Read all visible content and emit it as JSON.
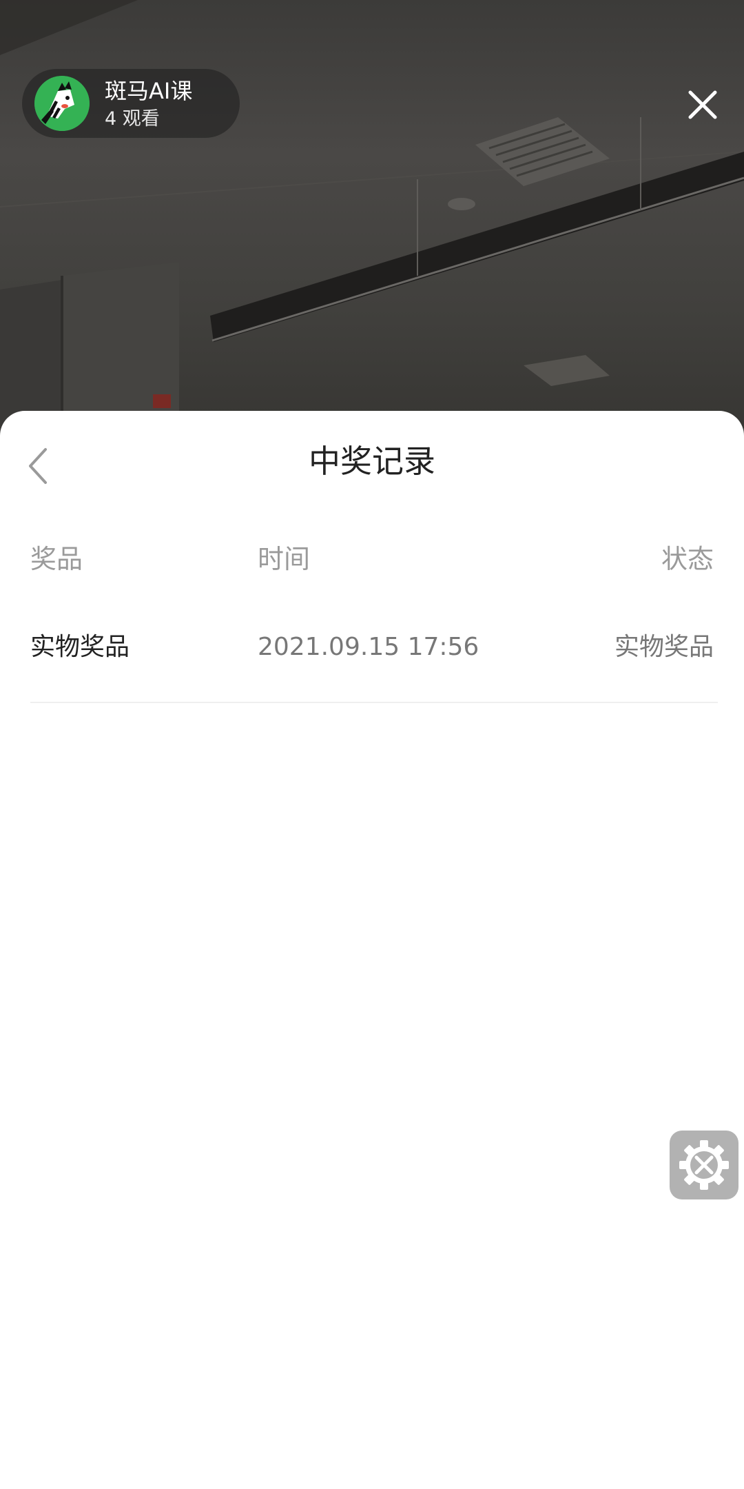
{
  "live": {
    "host_name": "斑马AI课",
    "viewer_count": "4",
    "viewer_suffix": "观看",
    "avatar_icon": "zebra-logo-icon",
    "close_icon": "close-icon"
  },
  "colors": {
    "avatar_bg": "#34b254",
    "sheet_bg": "#ffffff",
    "header_text": "#9a9a9a",
    "primary_text": "#222222",
    "secondary_text": "#777777"
  },
  "sheet": {
    "title": "中奖记录",
    "back_icon": "chevron-left-icon",
    "columns": {
      "prize": "奖品",
      "time": "时间",
      "status": "状态"
    },
    "rows": [
      {
        "prize": "实物奖品",
        "time": "2021.09.15 17:56",
        "status": "实物奖品"
      }
    ]
  },
  "floating": {
    "tools_icon": "tools-gear-icon"
  }
}
